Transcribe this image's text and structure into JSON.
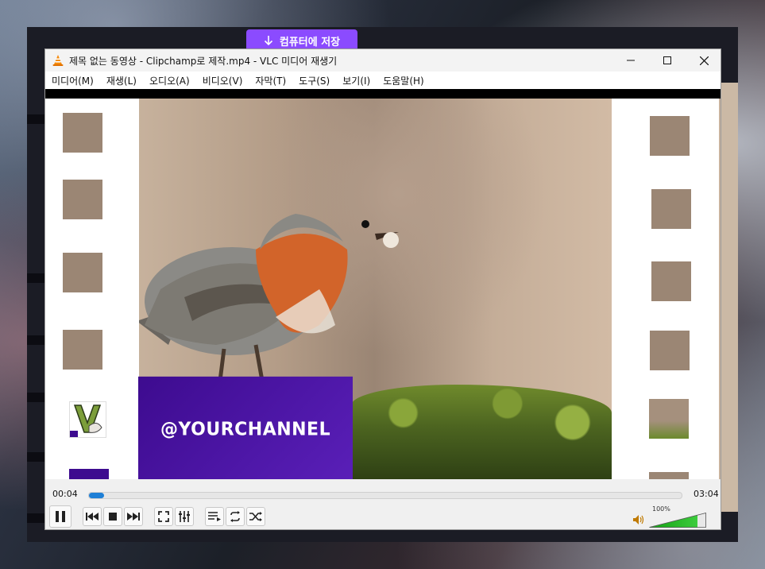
{
  "clipchamp": {
    "save_label": "컴퓨터에 저장",
    "save_icon": "download-arrow-icon",
    "accent": "#8b4bff"
  },
  "vlc": {
    "title": "제목 없는 동영상 - Clipchamp로 제작.mp4 - VLC 미디어 재생기",
    "app_icon": "vlc-cone-icon",
    "menu": [
      "미디어(M)",
      "재생(L)",
      "오디오(A)",
      "비디오(V)",
      "자막(T)",
      "도구(S)",
      "보기(I)",
      "도움말(H)"
    ],
    "video": {
      "overlay_text": "@YOURCHANNEL"
    },
    "controls": {
      "time_elapsed": "00:04",
      "time_total": "03:04",
      "progress": 0.022,
      "volume_label": "100%",
      "volume_level": 0.85,
      "accent": "#1e7fd6"
    }
  }
}
